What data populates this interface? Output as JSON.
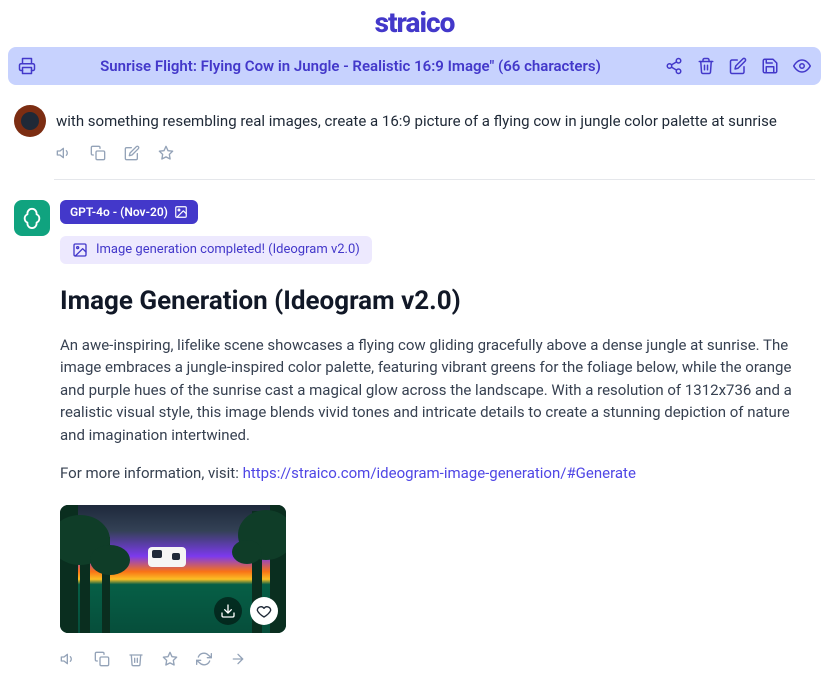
{
  "logo": "straico",
  "titleBar": {
    "title": "Sunrise Flight: Flying Cow in Jungle - Realistic 16:9 Image\" (66 characters)"
  },
  "userMessage": {
    "text": "with something resembling real images, create a 16:9 picture of a flying cow in jungle color palette at sunrise"
  },
  "aiResponse": {
    "modelBadge": "GPT-4o - (Nov-20)",
    "statusBadge": "Image generation completed! (Ideogram v2.0)",
    "heading": "Image Generation (Ideogram v2.0)",
    "description": "An awe-inspiring, lifelike scene showcases a flying cow gliding gracefully above a dense jungle at sunrise. The image embraces a jungle-inspired color palette, featuring vibrant greens for the foliage below, while the orange and purple hues of the sunrise cast a magical glow across the landscape. With a resolution of 1312x736 and a realistic visual style, this image blends vivid tones and intricate details to create a stunning depiction of nature and imagination intertwined.",
    "moreInfoPrefix": "For more information, visit: ",
    "moreInfoLink": "https://straico.com/ideogram-image-generation/#Generate"
  }
}
